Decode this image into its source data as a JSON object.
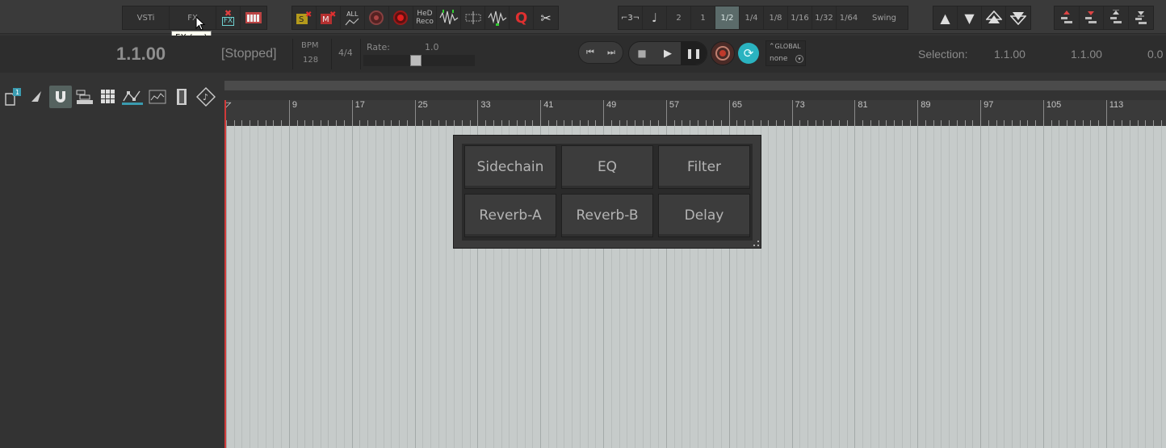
{
  "toolbar": {
    "vsti_label": "VSTi",
    "fx_label": "FX",
    "fx_tooltip": "FX (on)",
    "fx_badge": "FX",
    "all_label": "ALL",
    "hed_label_1": "HeD",
    "hed_label_2": "Reco",
    "q_label": "Q",
    "grid": {
      "triplet": "⌐3¬",
      "items": [
        "2",
        "1",
        "1/2",
        "1/4",
        "1/8",
        "1/16",
        "1/32",
        "1/64"
      ],
      "selected": "1/2",
      "swing": "Swing"
    }
  },
  "transport": {
    "position": "1.1.00",
    "state": "[Stopped]",
    "bpm_label": "BPM",
    "bpm_value": "128",
    "time_sig": "4/4",
    "rate_label": "Rate:",
    "rate_value": "1.0",
    "rate_level": 0.47,
    "global_label": "GLOBAL",
    "global_value": "none",
    "selection_label": "Selection:",
    "selection_start": "1.1.00",
    "selection_end": "1.1.00",
    "selection_len": "0.0"
  },
  "ruler": {
    "marks": [
      "9",
      "17",
      "25",
      "33",
      "41",
      "49",
      "57",
      "65",
      "73",
      "81",
      "89",
      "97",
      "105",
      "113"
    ]
  },
  "fx_panel": {
    "buttons": [
      "Sidechain",
      "EQ",
      "Filter",
      "Reverb-A",
      "Reverb-B",
      "Delay"
    ]
  },
  "colors": {
    "selected_bg": "#5b6b6a",
    "record_red": "#c0392b",
    "sync_cyan": "#2ab3c0",
    "arrange_bg": "#c6cbca"
  }
}
